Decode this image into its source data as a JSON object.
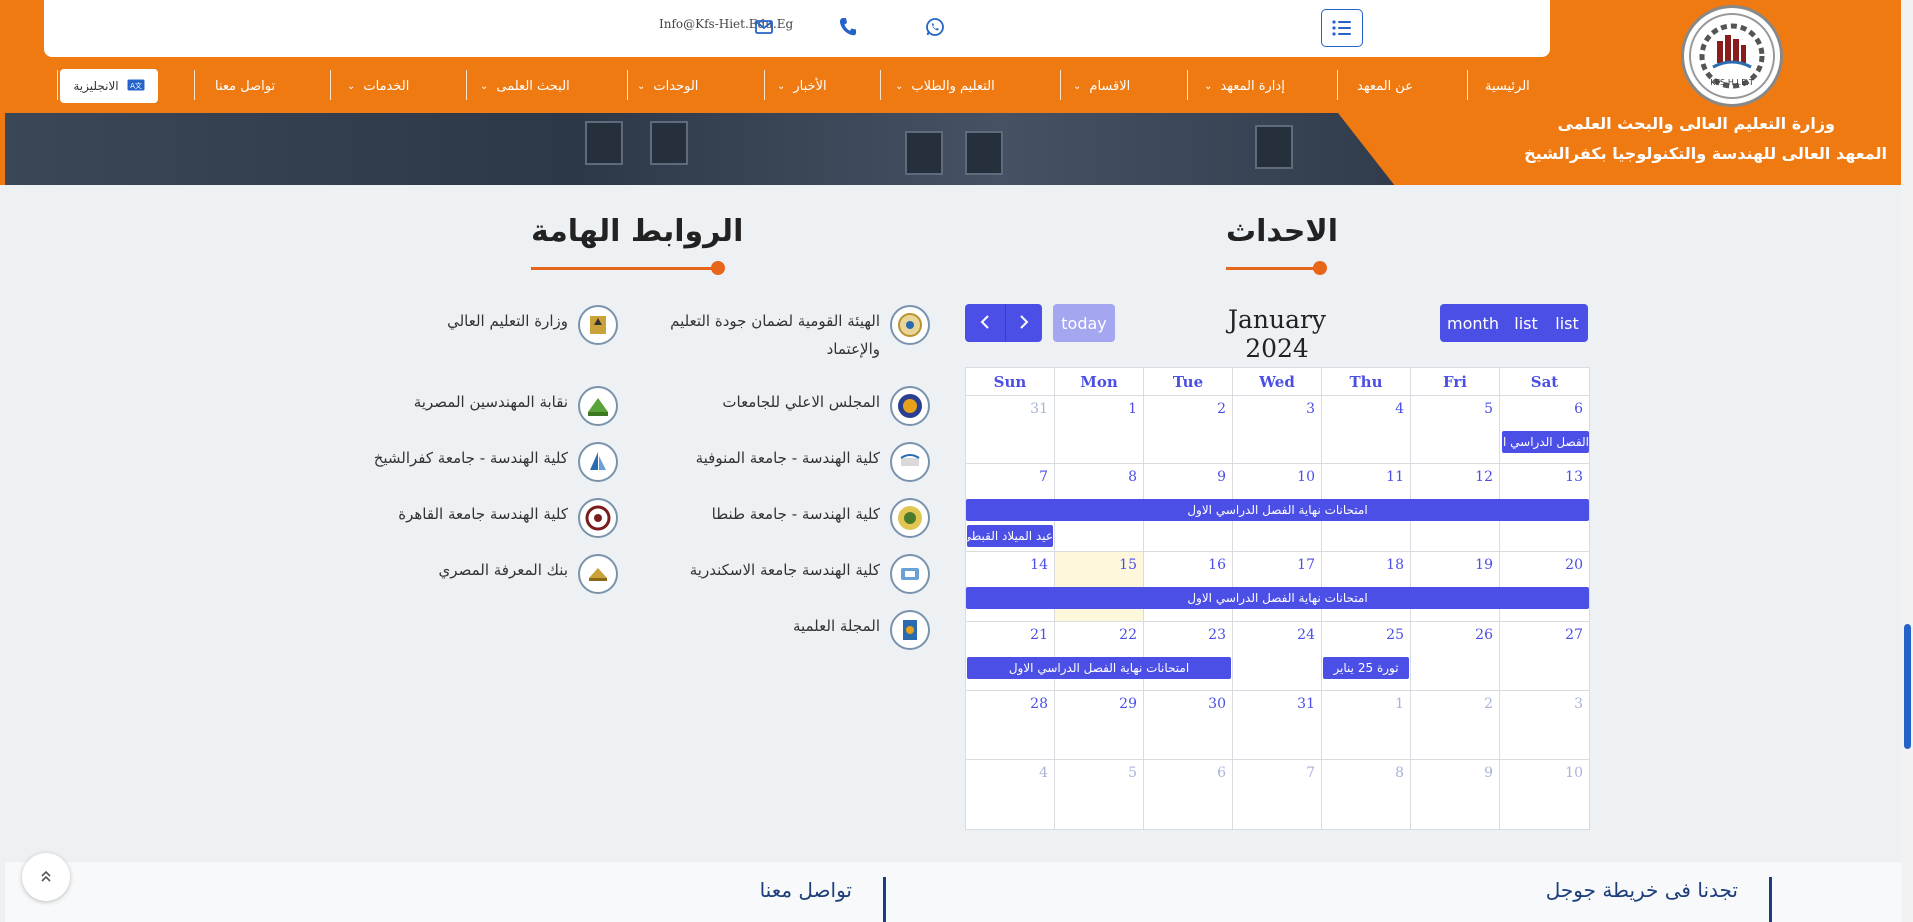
{
  "header": {
    "email": "Info@Kfs-Hiet.Edu.Eg",
    "brand_line1": "وزارة التعليم العالى والبحث العلمى",
    "brand_line2": "المعهد العالى للهندسة والتكنولوجيا بكفرالشيخ",
    "logo_text": "KFS-H.I.E.T",
    "nav": [
      {
        "label": "الرئيسية"
      },
      {
        "label": "عن المعهد"
      },
      {
        "label": "إدارة المعهد"
      },
      {
        "label": "الاقسام"
      },
      {
        "label": "التعليم والطلاب"
      },
      {
        "label": "الأخبار"
      },
      {
        "label": "الوحدات"
      },
      {
        "label": "البحث العلمى"
      },
      {
        "label": "الخدمات"
      },
      {
        "label": "تواصل معنا"
      }
    ],
    "lang_button": "الانجليزية",
    "accent": "#f07a12"
  },
  "events": {
    "title": "الاحداث",
    "calendar": {
      "title": "January 2024",
      "today_label": "today",
      "view_buttons": [
        "month",
        "list",
        "list"
      ],
      "weekdays": [
        "Sun",
        "Mon",
        "Tue",
        "Wed",
        "Thu",
        "Fri",
        "Sat"
      ],
      "weeks": [
        [
          "31",
          "1",
          "2",
          "3",
          "4",
          "5",
          "6"
        ],
        [
          "7",
          "8",
          "9",
          "10",
          "11",
          "12",
          "13"
        ],
        [
          "14",
          "15",
          "16",
          "17",
          "18",
          "19",
          "20"
        ],
        [
          "21",
          "22",
          "23",
          "24",
          "25",
          "26",
          "27"
        ],
        [
          "28",
          "29",
          "30",
          "31",
          "1",
          "2",
          "3"
        ],
        [
          "4",
          "5",
          "6",
          "7",
          "8",
          "9",
          "10"
        ]
      ],
      "events": {
        "w1_sat": "الفصل الدراسي الاول",
        "w2_bar": "امتحانات نهاية الفصل الدراسي الاول",
        "w2_sun": "عيد الميلاد القبطي",
        "w3_bar": "امتحانات نهاية الفصل الدراسي الاول",
        "w4_bar": "امتحانات نهاية الفصل الدراسي الاول",
        "w4_thu": "ثورة 25 يناير"
      },
      "accent": "#4b4fe6"
    }
  },
  "links": {
    "title": "الروابط الهامة",
    "items": [
      {
        "label": "الهيئة القومية لضمان جودة التعليم والإعتماد"
      },
      {
        "label": "وزارة التعليم العالي"
      },
      {
        "label": "المجلس الاعلي للجامعات"
      },
      {
        "label": "نقابة المهندسين المصرية"
      },
      {
        "label": "كلية الهندسة - جامعة المنوفية"
      },
      {
        "label": "كلية الهندسة - جامعة كفرالشيخ"
      },
      {
        "label": "كلية الهندسة - جامعة طنطا"
      },
      {
        "label": "كلية الهندسة جامعة القاهرة"
      },
      {
        "label": "كلية الهندسة جامعة الاسكندرية"
      },
      {
        "label": "بنك المعرفة المصري"
      },
      {
        "label": "المجلة العلمية"
      }
    ]
  },
  "footer": {
    "map_title": "تجدنا فى خريطة جوجل",
    "contact_title": "تواصل معنا"
  }
}
